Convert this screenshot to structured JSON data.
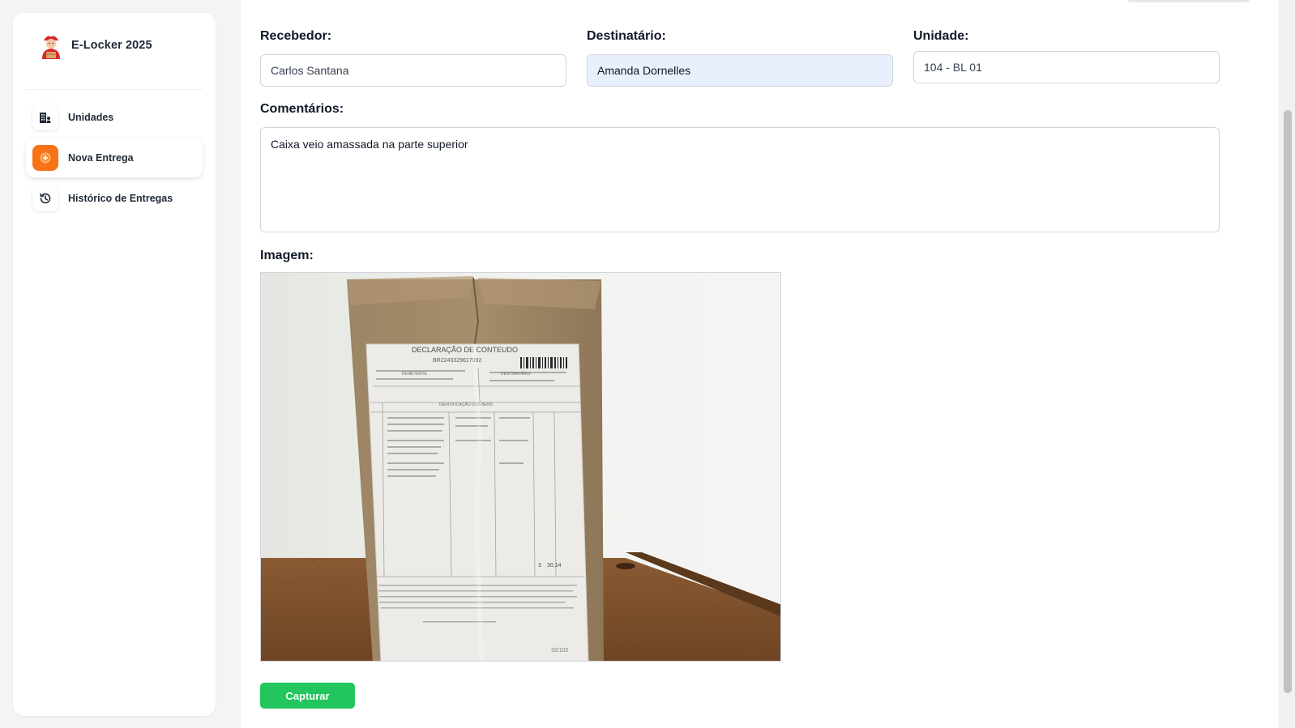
{
  "app": {
    "title": "E-Locker 2025"
  },
  "sidebar": {
    "items": [
      {
        "label": "Unidades",
        "icon": "building-icon",
        "active": false
      },
      {
        "label": "Nova Entrega",
        "icon": "plus-circle-icon",
        "active": true
      },
      {
        "label": "Histórico de Entregas",
        "icon": "history-icon",
        "active": false
      }
    ]
  },
  "form": {
    "recebedor": {
      "label": "Recebedor:",
      "value": "Carlos Santana"
    },
    "destinatario": {
      "label": "Destinatário:",
      "value": "Amanda Dornelles"
    },
    "unidade": {
      "label": "Unidade:",
      "value": "104 - BL 01"
    },
    "comentarios": {
      "label": "Comentários:",
      "value": "Caixa veio amassada na parte superior"
    },
    "imagem": {
      "label": "Imagem:"
    }
  },
  "photo_label": {
    "title": "DECLARAÇÃO DE CONTEUDO",
    "code": "BR2243329617092",
    "remetente": "REMETENTE",
    "destinatario": "DESTINATÁRIO",
    "identificacao": "IDENTIFICAÇÃO DOS BENS",
    "footer_code": "32/102",
    "total_qty": "3",
    "total_value": "30,14"
  },
  "actions": {
    "capture_label": "Capturar"
  },
  "colors": {
    "accent": "#f97316",
    "success": "#22c55e",
    "filled_input": "#e8f0fe"
  }
}
